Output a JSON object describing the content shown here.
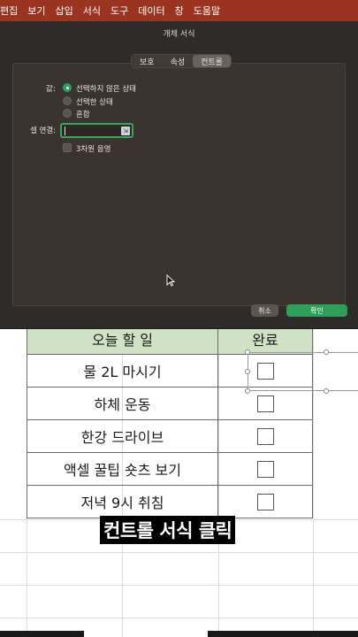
{
  "menubar": {
    "items": [
      "편집",
      "보기",
      "삽입",
      "서식",
      "도구",
      "데이터",
      "창",
      "도움말"
    ]
  },
  "dialog": {
    "title": "개체 서식",
    "tabs": [
      {
        "label": "보호",
        "active": false
      },
      {
        "label": "속성",
        "active": false
      },
      {
        "label": "컨트롤",
        "active": true
      }
    ],
    "value_label": "값:",
    "options": [
      {
        "label": "선택하지 않은 상태",
        "selected": true
      },
      {
        "label": "선택한 상태",
        "selected": false
      },
      {
        "label": "혼합",
        "selected": false
      }
    ],
    "cell_link_label": "셀 연결:",
    "cell_link_value": "",
    "shading_label": "3차원 음영",
    "shading_checked": false,
    "cancel_label": "취소",
    "ok_label": "확인"
  },
  "sheet": {
    "header": {
      "task": "오늘 할 일",
      "done": "완료"
    },
    "rows": [
      {
        "task": "물 2L 마시기",
        "checked": false
      },
      {
        "task": "하체 운동",
        "checked": false
      },
      {
        "task": "한강 드라이브",
        "checked": false
      },
      {
        "task": "액셀 꿀팁 숏츠 보기",
        "checked": false
      },
      {
        "task": "저녁 9시 취침",
        "checked": false
      }
    ]
  },
  "caption": "컨트롤 서식 클릭",
  "colors": {
    "menubar": "#9a3320",
    "dialog_bg": "#2f2b28",
    "accent_green": "#2f9e57",
    "header_green": "#cfe3c4"
  }
}
